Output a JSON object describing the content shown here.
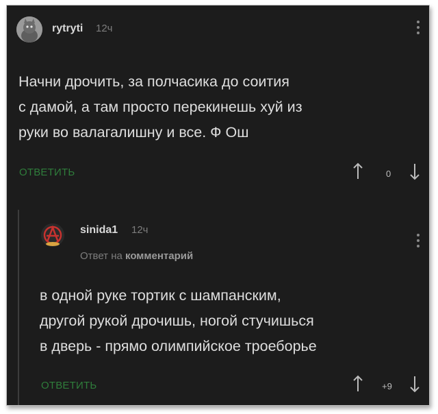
{
  "comment": {
    "username": "rytryti",
    "time": "12ч",
    "text_lines": [
      "Начни дрочить, за полчасика до соития",
      "с дамой, а там просто перекинешь хуй из",
      "руки во валагалишну и все. Ф Ош"
    ],
    "reply_label": "ОТВЕТИТЬ",
    "rating": "0"
  },
  "reply": {
    "username": "sinida1",
    "time": "12ч",
    "reply_prefix": "Ответ на",
    "reply_target": "комментарий",
    "text_lines": [
      "в одной руке тортик с шампанским,",
      "другой рукой дрочишь, ногой стучишься",
      "в дверь - прямо олимпийское троеборье"
    ],
    "reply_label": "ОТВЕТИТЬ",
    "rating": "+9"
  },
  "colors": {
    "background": "#1c1c1c",
    "reply_green": "#2f7d3b",
    "text": "#dedede",
    "muted": "#7d7d7d"
  },
  "icons": [
    "cat-avatar-icon",
    "anarchy-avatar-icon",
    "more-vertical-icon",
    "arrow-up-icon",
    "arrow-down-icon"
  ]
}
